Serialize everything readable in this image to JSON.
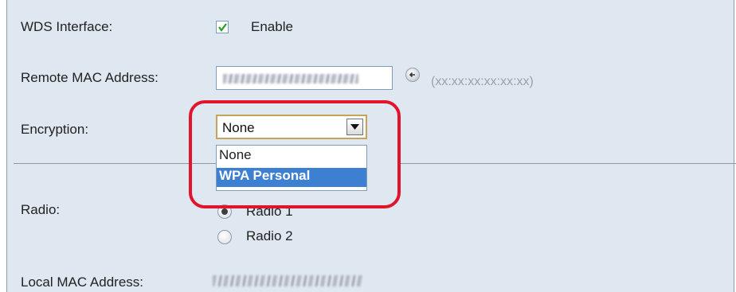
{
  "wds": {
    "label": "WDS Interface:",
    "checked": true,
    "enable_label": "Enable"
  },
  "remote_mac": {
    "label": "Remote MAC Address:",
    "value_obscured": true,
    "format_hint": "(xx:xx:xx:xx:xx:xx)",
    "icon": "arrow-left-icon"
  },
  "encryption": {
    "label": "Encryption:",
    "selected": "None",
    "options": [
      "None",
      "WPA Personal"
    ],
    "highlighted_option": "WPA Personal"
  },
  "radio": {
    "label": "Radio:",
    "options": [
      "Radio 1",
      "Radio 2"
    ],
    "selected": "Radio 1"
  },
  "local_mac": {
    "label": "Local MAC Address:",
    "value_obscured": true
  },
  "colors": {
    "panel_bg": "#dfe7f1",
    "highlight_ring": "#e2142b",
    "selection_blue": "#3d7fd0"
  }
}
